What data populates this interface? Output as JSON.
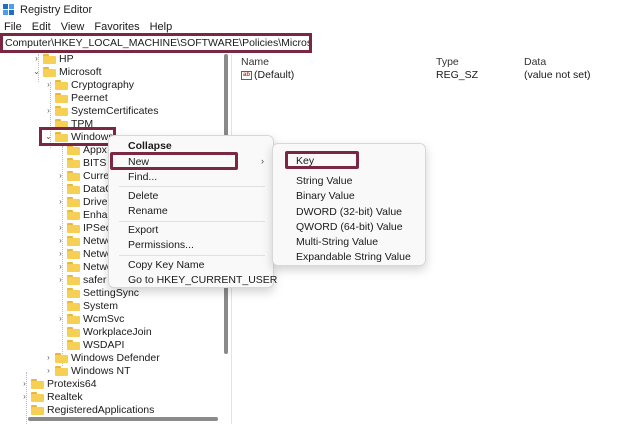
{
  "window": {
    "title": "Registry Editor"
  },
  "menu": [
    "File",
    "Edit",
    "View",
    "Favorites",
    "Help"
  ],
  "address": "Computer\\HKEY_LOCAL_MACHINE\\SOFTWARE\\Policies\\Microsoft\\Windows",
  "tree": [
    {
      "label": "HP",
      "chevron": ">"
    },
    {
      "label": "Microsoft",
      "chevron": "v"
    },
    {
      "label": "Cryptography",
      "chevron": ">"
    },
    {
      "label": "Peernet",
      "chevron": ""
    },
    {
      "label": "SystemCertificates",
      "chevron": ">"
    },
    {
      "label": "TPM",
      "chevron": ""
    },
    {
      "label": "Windows",
      "chevron": "v"
    },
    {
      "label": "Appx",
      "chevron": ""
    },
    {
      "label": "BITS",
      "chevron": ""
    },
    {
      "label": "Curren",
      "chevron": ">"
    },
    {
      "label": "DataC",
      "chevron": ""
    },
    {
      "label": "Driver",
      "chevron": ">"
    },
    {
      "label": "Enhan",
      "chevron": ""
    },
    {
      "label": "IPSec",
      "chevron": ">"
    },
    {
      "label": "Netwo",
      "chevron": ">"
    },
    {
      "label": "Netwo",
      "chevron": ">"
    },
    {
      "label": "Netwo",
      "chevron": ">"
    },
    {
      "label": "safer",
      "chevron": ">"
    },
    {
      "label": "SettingSync",
      "chevron": ""
    },
    {
      "label": "System",
      "chevron": ""
    },
    {
      "label": "WcmSvc",
      "chevron": ">"
    },
    {
      "label": "WorkplaceJoin",
      "chevron": ""
    },
    {
      "label": "WSDAPI",
      "chevron": ""
    },
    {
      "label": "Windows Defender",
      "chevron": ">"
    },
    {
      "label": "Windows NT",
      "chevron": ">"
    },
    {
      "label": "Protexis64",
      "chevron": ">"
    },
    {
      "label": "Realtek",
      "chevron": ">"
    },
    {
      "label": "RegisteredApplications",
      "chevron": ""
    }
  ],
  "columns": {
    "name": "Name",
    "type": "Type",
    "data": "Data"
  },
  "values": [
    {
      "name": "(Default)",
      "type": "REG_SZ",
      "data": "(value not set)",
      "icon": "ab-string-icon"
    }
  ],
  "context_menu": {
    "collapse": "Collapse",
    "new": "New",
    "find": "Find...",
    "delete": "Delete",
    "rename": "Rename",
    "export": "Export",
    "permissions": "Permissions...",
    "copy_key_name": "Copy Key Name",
    "goto": "Go to HKEY_CURRENT_USER"
  },
  "submenu": {
    "key": "Key",
    "string": "String Value",
    "binary": "Binary Value",
    "dword": "DWORD (32-bit) Value",
    "qword": "QWORD (64-bit) Value",
    "multi": "Multi-String Value",
    "expandable": "Expandable String Value"
  },
  "colors": {
    "highlight": "#7a2741",
    "folder": "#f6cf55"
  }
}
